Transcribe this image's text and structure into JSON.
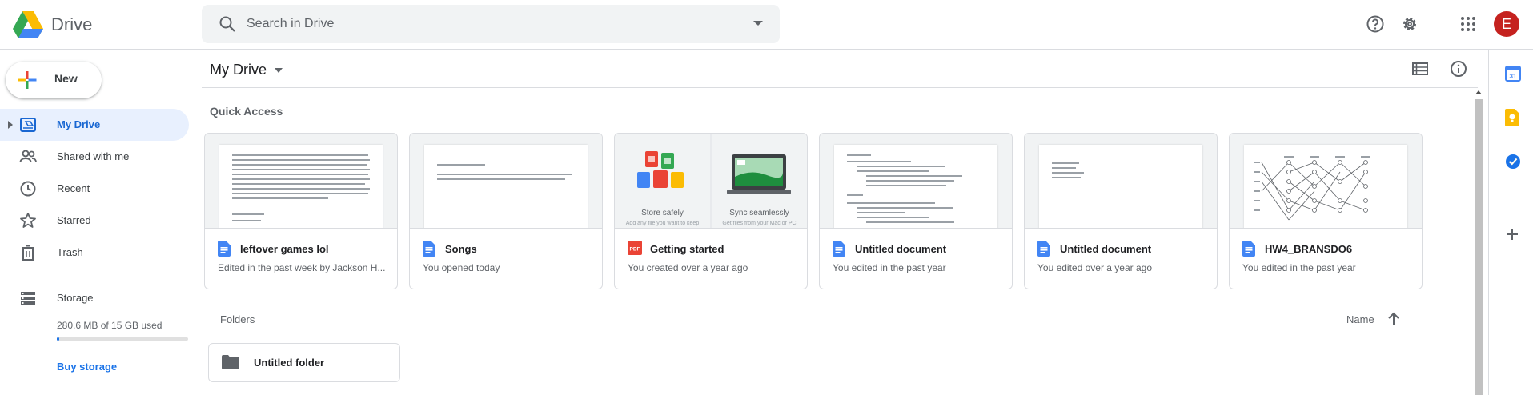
{
  "app": {
    "title": "Drive",
    "search_placeholder": "Search in Drive",
    "avatar_initial": "E"
  },
  "sidebar": {
    "new_label": "New",
    "items": [
      {
        "label": "My Drive",
        "icon": "my-drive-icon",
        "active": true
      },
      {
        "label": "Shared with me",
        "icon": "people-icon"
      },
      {
        "label": "Recent",
        "icon": "clock-icon"
      },
      {
        "label": "Starred",
        "icon": "star-icon"
      },
      {
        "label": "Trash",
        "icon": "trash-icon"
      }
    ],
    "storage": {
      "label": "Storage",
      "used_text": "280.6 MB of 15 GB used",
      "used_fraction": 0.018,
      "buy_label": "Buy storage"
    }
  },
  "main": {
    "title": "My Drive",
    "quick_access_label": "Quick Access",
    "folders_label": "Folders",
    "sort_label": "Name",
    "files": [
      {
        "name": "leftover games lol",
        "meta": "Edited in the past week by Jackson H...",
        "type": "doc"
      },
      {
        "name": "Songs",
        "meta": "You opened today",
        "type": "doc"
      },
      {
        "name": "Getting started",
        "meta": "You created over a year ago",
        "type": "pdf",
        "thumb_left": "Store safely",
        "thumb_right": "Sync seamlessly",
        "thumb_left_sub": "Add any file you want to keep",
        "thumb_right_sub": "Get files from your Mac or PC"
      },
      {
        "name": "Untitled document",
        "meta": "You edited in the past year",
        "type": "doc"
      },
      {
        "name": "Untitled document",
        "meta": "You edited over a year ago",
        "type": "doc"
      },
      {
        "name": "HW4_BRANSDO6",
        "meta": "You edited in the past year",
        "type": "doc"
      }
    ],
    "folders": [
      {
        "name": "Untitled folder"
      }
    ]
  },
  "colors": {
    "accent": "#1a73e8",
    "active_bg": "#e8f0fe",
    "doc_blue": "#4285f4",
    "pdf_red": "#ea4335",
    "avatar": "#c5221f"
  }
}
